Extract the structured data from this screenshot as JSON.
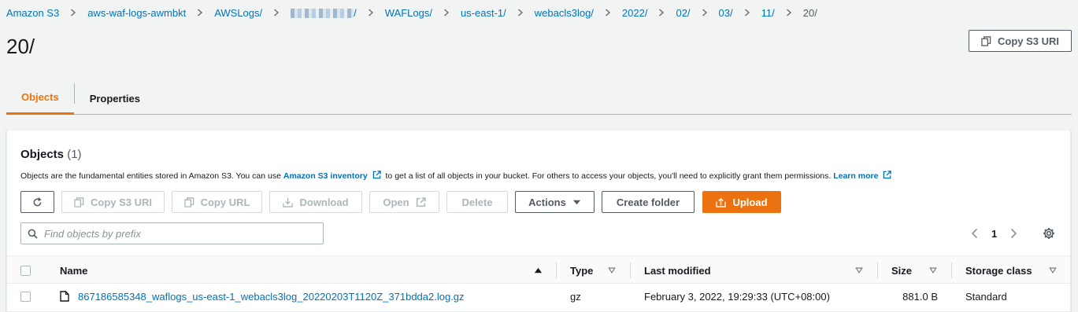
{
  "breadcrumb": {
    "items": [
      "Amazon S3",
      "aws-waf-logs-awmbkt",
      "AWSLogs/",
      "/",
      "WAFLogs/",
      "us-east-1/",
      "webacls3log/",
      "2022/",
      "02/",
      "03/",
      "11/"
    ],
    "current": "20/"
  },
  "page": {
    "title": "20/",
    "copy_uri_label": "Copy S3 URI"
  },
  "tabs": [
    "Objects",
    "Properties"
  ],
  "panel": {
    "title": "Objects",
    "count": "(1)",
    "desc_before": "Objects are the fundamental entities stored in Amazon S3. You can use",
    "desc_inventory_link": "Amazon S3 inventory",
    "desc_middle": "to get a list of all objects in your bucket. For others to access your objects, you'll need to explicitly grant them permissions.",
    "desc_learn_more": "Learn more"
  },
  "toolbar": {
    "copy_s3_uri": "Copy S3 URI",
    "copy_url": "Copy URL",
    "download": "Download",
    "open": "Open",
    "delete": "Delete",
    "actions": "Actions",
    "create_folder": "Create folder",
    "upload": "Upload"
  },
  "search": {
    "placeholder": "Find objects by prefix"
  },
  "pagination": {
    "current_page": "1"
  },
  "table": {
    "columns": [
      "Name",
      "Type",
      "Last modified",
      "Size",
      "Storage class"
    ],
    "rows": [
      {
        "name": "867186585348_waflogs_us-east-1_webacls3log_20220203T1120Z_371bdda2.log.gz",
        "type": "gz",
        "last_modified": "February 3, 2022, 19:29:33 (UTC+08:00)",
        "size": "881.0 B",
        "storage_class": "Standard"
      }
    ]
  },
  "colors": {
    "link": "#0073bb",
    "accent": "#ec7211",
    "text": "#16191f",
    "muted": "#545b64"
  }
}
